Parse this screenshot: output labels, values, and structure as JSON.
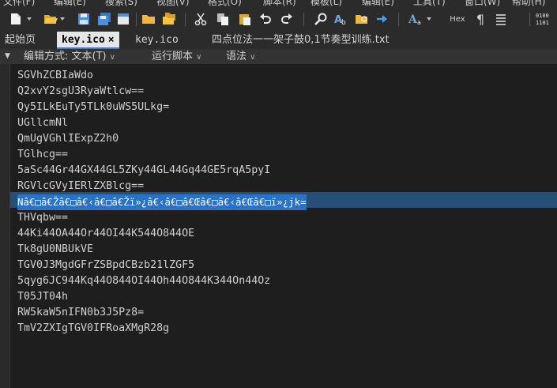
{
  "menu": {
    "items": [
      "文件(F)",
      "编辑(E)",
      "搜索(S)",
      "视图(V)",
      "格式(O)",
      "脚本(R)",
      "模板(L)",
      "编辑(E)",
      "工具(T)",
      "窗口(W)",
      "帮助(H)"
    ]
  },
  "toolbar": {
    "buttons": [
      "new-file-icon",
      "open-folder-icon",
      "save-icon",
      "save-all-icon",
      "folder-icon",
      "folders-icon",
      "cut-icon",
      "copy-icon",
      "paste-icon",
      "undo-icon",
      "redo-icon",
      "find-icon",
      "replace-icon",
      "find-in-files-icon",
      "goto-icon",
      "font-icon",
      "hex-icon",
      "pilcrow-icon",
      "word-wrap-icon",
      "binary-icon"
    ],
    "hex_label": "Hex"
  },
  "tabs": [
    {
      "label": "起始页"
    },
    {
      "label": "key.ico",
      "active": true,
      "close": "×"
    },
    {
      "label": "key.ico"
    },
    {
      "label": "四点位法一一架子鼓0,1节奏型训练.txt"
    }
  ],
  "options_bar": {
    "edit_mode": "编辑方式: 文本(T)",
    "run_script": "运行脚本",
    "syntax": "语法"
  },
  "editor": {
    "lines": [
      "SGVhZCBIaWdo",
      "Q2xvY2sgU3RyaWtlcw==",
      "Qy5ILkEuTy5TLk0uWS5ULkg=",
      "UGllcmNl",
      "QmUgVGhlIExpZ2h0",
      "TGlhcg==",
      "5aSc44Gr44GX44GL5ZKy44GL44Gq44GE5rqA5pyI",
      "RGVlcGVyIERlZXBlcg==",
      "Nâ€□â€Žâ€□â€‹â€□â€Žï»¿â€‹â€□â€Œâ€□â€‹â€Œâ€□ï»¿jk=",
      "THVqbw==",
      "44Ki44OA44Or44OI44K544O844OE",
      "Tk8gU0NBUkVE",
      "TGV0J3MgdGFrZSBpdCBzb21lZGF5",
      "5qyg6JC944Kq44O844OI44Oh44O844K344On44Oz",
      "T05JT04h",
      "RW5kaW5nIFN0b3J5Pz8=",
      "TmV2ZXIgTGV0IFRoaXMgR28g"
    ],
    "selected_line": 8
  }
}
